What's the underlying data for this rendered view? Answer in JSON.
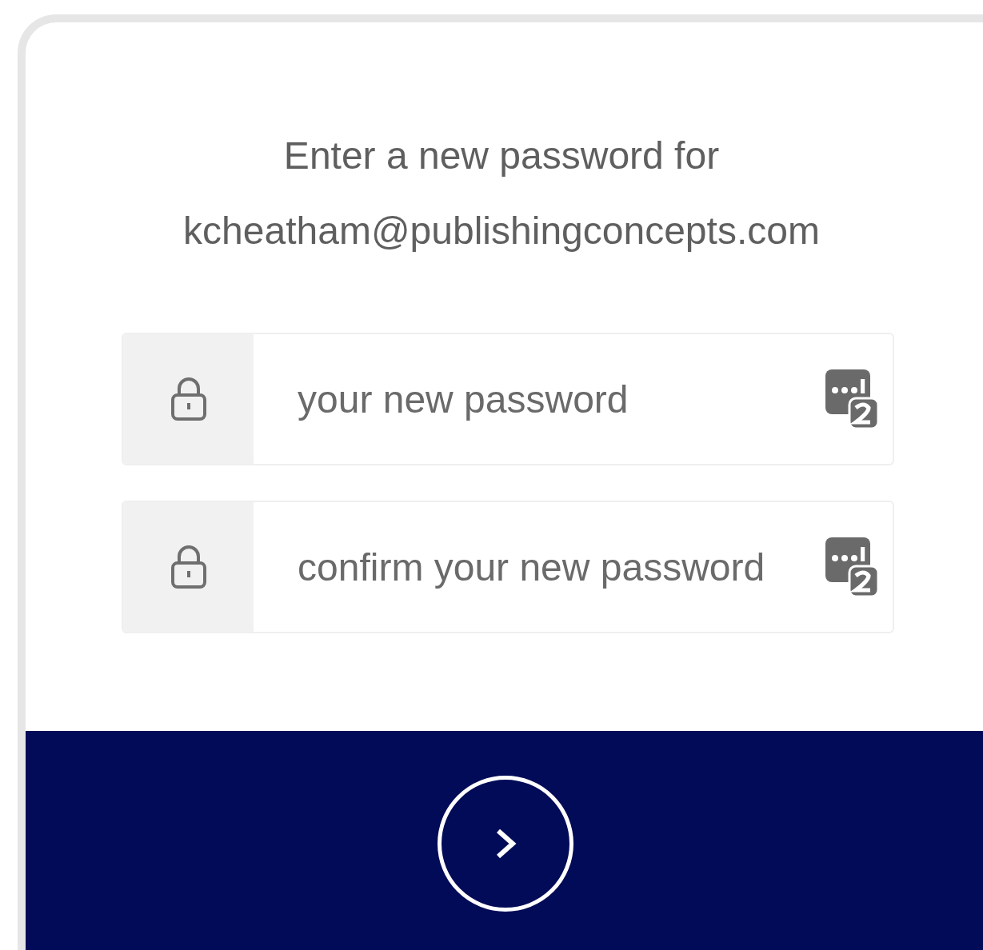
{
  "prompt": "Enter a new password for",
  "email": "kcheatham@publishingconcepts.com",
  "fields": [
    {
      "placeholder": "your new password"
    },
    {
      "placeholder": "confirm your new password"
    }
  ]
}
